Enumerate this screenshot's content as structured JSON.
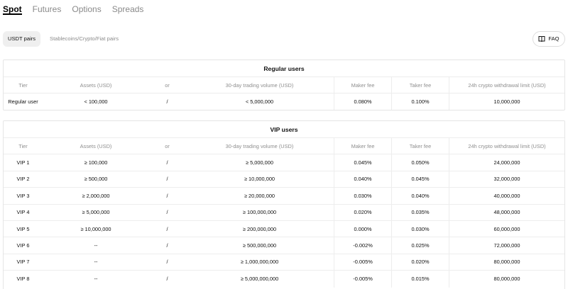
{
  "tabs": [
    "Spot",
    "Futures",
    "Options",
    "Spreads"
  ],
  "pairs": {
    "active": "USDT pairs",
    "other": "Stablecoins/Crypto/Fiat pairs"
  },
  "faq": {
    "label": "FAQ",
    "icon": "book-icon"
  },
  "columns": [
    "Tier",
    "Assets (USD)",
    "or",
    "30-day trading volume (USD)",
    "Maker fee",
    "Taker fee",
    "24h crypto withdrawal limit (USD)"
  ],
  "regular": {
    "title": "Regular users",
    "rows": [
      [
        "Regular user",
        "< 100,000",
        "/",
        "< 5,000,000",
        "0.080%",
        "0.100%",
        "10,000,000"
      ]
    ]
  },
  "vip": {
    "title": "VIP users",
    "rows": [
      [
        "VIP 1",
        "≥ 100,000",
        "/",
        "≥ 5,000,000",
        "0.045%",
        "0.050%",
        "24,000,000"
      ],
      [
        "VIP 2",
        "≥ 500,000",
        "/",
        "≥ 10,000,000",
        "0.040%",
        "0.045%",
        "32,000,000"
      ],
      [
        "VIP 3",
        "≥ 2,000,000",
        "/",
        "≥ 20,000,000",
        "0.030%",
        "0.040%",
        "40,000,000"
      ],
      [
        "VIP 4",
        "≥ 5,000,000",
        "/",
        "≥ 100,000,000",
        "0.020%",
        "0.035%",
        "48,000,000"
      ],
      [
        "VIP 5",
        "≥ 10,000,000",
        "/",
        "≥ 200,000,000",
        "0.000%",
        "0.030%",
        "60,000,000"
      ],
      [
        "VIP 6",
        "--",
        "/",
        "≥ 500,000,000",
        "-0.002%",
        "0.025%",
        "72,000,000"
      ],
      [
        "VIP 7",
        "--",
        "/",
        "≥ 1,000,000,000",
        "-0.005%",
        "0.020%",
        "80,000,000"
      ],
      [
        "VIP 8",
        "--",
        "/",
        "≥ 5,000,000,000",
        "-0.005%",
        "0.015%",
        "80,000,000"
      ]
    ]
  }
}
